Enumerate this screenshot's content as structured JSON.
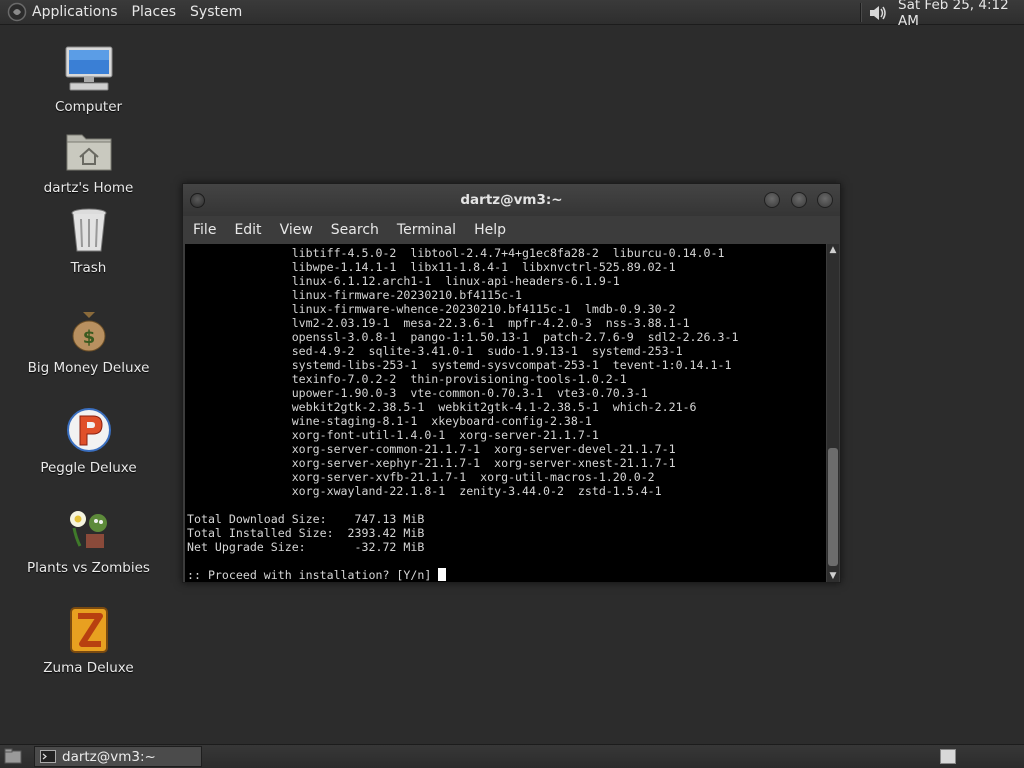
{
  "top_panel": {
    "menus": [
      "Applications",
      "Places",
      "System"
    ],
    "clock": "Sat Feb 25,  4:12 AM"
  },
  "desktop": {
    "icons": [
      {
        "label": "Computer",
        "icon": "computer-icon"
      },
      {
        "label": "dartz's Home",
        "icon": "home-folder-icon"
      },
      {
        "label": "Trash",
        "icon": "trash-icon"
      },
      {
        "label": "Big Money Deluxe",
        "icon": "money-bag-icon"
      },
      {
        "label": "Peggle Deluxe",
        "icon": "peggle-icon"
      },
      {
        "label": "Plants vs Zombies",
        "icon": "plants-vs-zombies-icon"
      },
      {
        "label": "Zuma Deluxe",
        "icon": "zuma-icon"
      }
    ]
  },
  "terminal": {
    "title": "dartz@vm3:~",
    "menus": [
      "File",
      "Edit",
      "View",
      "Search",
      "Terminal",
      "Help"
    ],
    "lines": [
      "               libtiff-4.5.0-2  libtool-2.4.7+4+g1ec8fa28-2  liburcu-0.14.0-1",
      "               libwpe-1.14.1-1  libx11-1.8.4-1  libxnvctrl-525.89.02-1",
      "               linux-6.1.12.arch1-1  linux-api-headers-6.1.9-1",
      "               linux-firmware-20230210.bf4115c-1",
      "               linux-firmware-whence-20230210.bf4115c-1  lmdb-0.9.30-2",
      "               lvm2-2.03.19-1  mesa-22.3.6-1  mpfr-4.2.0-3  nss-3.88.1-1",
      "               openssl-3.0.8-1  pango-1:1.50.13-1  patch-2.7.6-9  sdl2-2.26.3-1",
      "               sed-4.9-2  sqlite-3.41.0-1  sudo-1.9.13-1  systemd-253-1",
      "               systemd-libs-253-1  systemd-sysvcompat-253-1  tevent-1:0.14.1-1",
      "               texinfo-7.0.2-2  thin-provisioning-tools-1.0.2-1",
      "               upower-1.90.0-3  vte-common-0.70.3-1  vte3-0.70.3-1",
      "               webkit2gtk-2.38.5-1  webkit2gtk-4.1-2.38.5-1  which-2.21-6",
      "               wine-staging-8.1-1  xkeyboard-config-2.38-1",
      "               xorg-font-util-1.4.0-1  xorg-server-21.1.7-1",
      "               xorg-server-common-21.1.7-1  xorg-server-devel-21.1.7-1",
      "               xorg-server-xephyr-21.1.7-1  xorg-server-xnest-21.1.7-1",
      "               xorg-server-xvfb-21.1.7-1  xorg-util-macros-1.20.0-2",
      "               xorg-xwayland-22.1.8-1  zenity-3.44.0-2  zstd-1.5.4-1",
      "",
      "Total Download Size:    747.13 MiB",
      "Total Installed Size:  2393.42 MiB",
      "Net Upgrade Size:       -32.72 MiB",
      "",
      ":: Proceed with installation? [Y/n] "
    ]
  },
  "taskbar": {
    "task_label": "dartz@vm3:~"
  }
}
